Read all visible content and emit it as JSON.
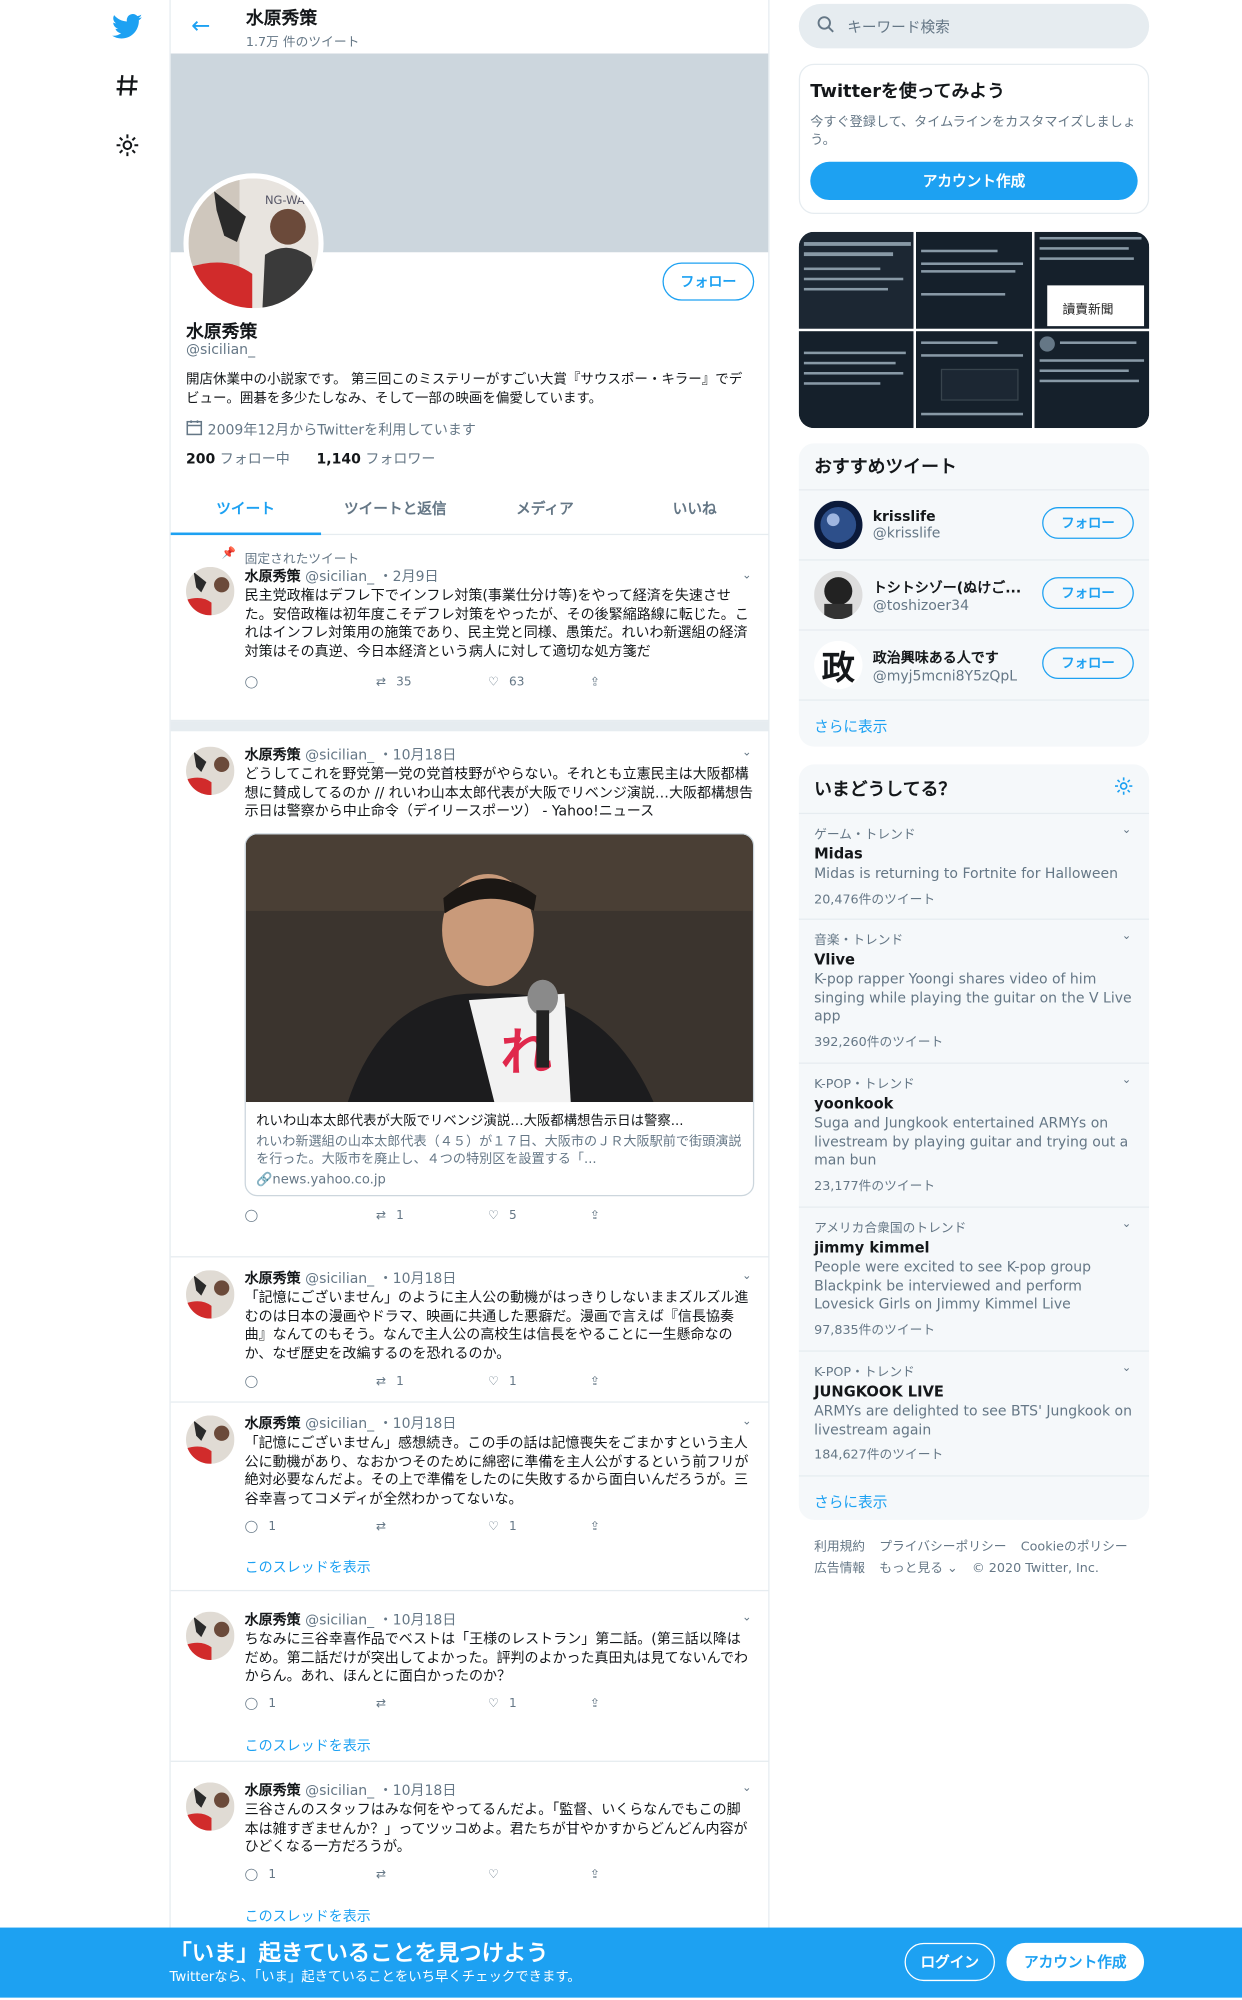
{
  "nav": {
    "items": [
      "twitter-logo",
      "explore",
      "settings"
    ]
  },
  "header": {
    "name": "水原秀策",
    "tweet_count": "1.7万 件のツイート"
  },
  "profile": {
    "name": "水原秀策",
    "handle": "@sicilian_",
    "follow_label": "フォロー",
    "bio": "開店休業中の小説家です。 第三回このミステリーがすごい大賞『サウスポー・キラー』でデビュー。囲碁を多少たしなみ、そして一部の映画を偏愛しています。",
    "joined": "2009年12月からTwitterを利用しています",
    "following_count": "200",
    "following_label": "フォロー中",
    "followers_count": "1,140",
    "followers_label": "フォロワー"
  },
  "tabs": [
    "ツイート",
    "ツイートと返信",
    "メディア",
    "いいね"
  ],
  "tweets": [
    {
      "pinned": "固定されたツイート",
      "name": "水原秀策",
      "handle": "@sicilian_",
      "date": "・2月9日",
      "text": "民主党政権はデフレ下でインフレ対策(事業仕分け等)をやって経済を失速させた。安倍政権は初年度こそデフレ対策をやったが、その後緊縮路線に転じた。これはインフレ対策用の施策であり、民主党と同様、愚策だ。れいわ新選組の経済対策はその真逆、今日本経済という病人に対して適切な処方箋だ",
      "reply": "",
      "retweet": "35",
      "like": "63"
    },
    {
      "name": "水原秀策",
      "handle": "@sicilian_",
      "date": "・10月18日",
      "text": "どうしてこれを野党第一党の党首枝野がやらない。それとも立憲民主は大阪都構想に賛成してるのか // れいわ山本太郎代表が大阪でリベンジ演説…大阪都構想告示日は警察から中止命令（デイリースポーツ） - Yahoo!ニュース",
      "card_title": "れいわ山本太郎代表が大阪でリベンジ演説…大阪都構想告示日は警察...",
      "card_desc": "れいわ新選組の山本太郎代表（４５）が１７日、大阪市のＪＲ大阪駅前で街頭演説を行った。大阪市を廃止し、４つの特別区を設置する「...",
      "card_domain": "news.yahoo.co.jp",
      "reply": "",
      "retweet": "1",
      "like": "5"
    },
    {
      "name": "水原秀策",
      "handle": "@sicilian_",
      "date": "・10月18日",
      "text": "「記憶にございません」のように主人公の動機がはっきりしないままズルズル進むのは日本の漫画やドラマ、映画に共通した悪癖だ。漫画で言えば『信長協奏曲』なんてのもそう。なんで主人公の高校生は信長をやることに一生懸命なのか、なぜ歴史を改編するのを恐れるのか。",
      "reply": "",
      "retweet": "1",
      "like": "1"
    },
    {
      "name": "水原秀策",
      "handle": "@sicilian_",
      "date": "・10月18日",
      "text": "「記憶にございません」感想続き。この手の話は記憶喪失をごまかすという主人公に動機があり、なおかつそのために綿密に準備を主人公がするという前フリが絶対必要なんだよ。その上で準備をしたのに失敗するから面白いんだろうが。三谷幸喜ってコメディが全然わかってないな。",
      "reply": "1",
      "retweet": "",
      "like": "1",
      "thread": "このスレッドを表示"
    },
    {
      "name": "水原秀策",
      "handle": "@sicilian_",
      "date": "・10月18日",
      "text": "ちなみに三谷幸喜作品でベストは「王様のレストラン」第二話。(第三話以降はだめ。第二話だけが突出してよかった。評判のよかった真田丸は見てないんでわからん。あれ、ほんとに面白かったのか？",
      "reply": "1",
      "retweet": "",
      "like": "1",
      "thread": "このスレッドを表示"
    },
    {
      "name": "水原秀策",
      "handle": "@sicilian_",
      "date": "・10月18日",
      "text": "三谷さんのスタッフはみな何をやってるんだよ。「監督、いくらなんでもこの脚本は雑すぎませんか？」ってツッコめよ。君たちが甘やかすからどんどん内容がひどくなる一方だろうが。",
      "reply": "1",
      "retweet": "",
      "like": "",
      "thread": "このスレッドを表示"
    }
  ],
  "sidebar": {
    "search_placeholder": "キーワード検索",
    "signup": {
      "title": "Twitterを使ってみよう",
      "desc": "今すぐ登録して、タイムラインをカスタマイズしましょう。",
      "button": "アカウント作成"
    },
    "recommend": {
      "title": "おすすめツイート",
      "users": [
        {
          "name": "krisslife",
          "handle": "@krisslife",
          "button": "フォロー"
        },
        {
          "name": "トシトシゾー(ぬけご...",
          "handle": "@toshizoer34",
          "button": "フォロー"
        },
        {
          "name": "政治興味ある人です",
          "handle": "@myj5mcni8Y5zQpL",
          "button": "フォロー",
          "avatar_char": "政"
        }
      ],
      "more": "さらに表示"
    },
    "trends": {
      "title": "いまどうしてる？",
      "items": [
        {
          "cat": "ゲーム・トレンド",
          "name": "Midas",
          "desc": "Midas is returning to Fortnite for Halloween",
          "count": "20,476件のツイート"
        },
        {
          "cat": "音楽・トレンド",
          "name": "Vlive",
          "desc": "K-pop rapper Yoongi shares video of him singing while playing the guitar on the V Live app",
          "count": "392,260件のツイート"
        },
        {
          "cat": "K-POP・トレンド",
          "name": "yoonkook",
          "desc": "Suga and Jungkook entertained ARMYs on livestream by playing guitar and trying out a man bun",
          "count": "23,177件のツイート"
        },
        {
          "cat": "アメリカ合衆国のトレンド",
          "name": "jimmy kimmel",
          "desc": "People were excited to see K-pop group Blackpink be interviewed and perform Lovesick Girls on Jimmy Kimmel Live",
          "count": "97,835件のツイート"
        },
        {
          "cat": "K-POP・トレンド",
          "name": "JUNGKOOK LIVE",
          "desc": "ARMYs are delighted to see BTS' Jungkook on livestream again",
          "count": "184,627件のツイート"
        }
      ],
      "more": "さらに表示"
    },
    "footer": {
      "terms": "利用規約",
      "privacy": "プライバシーポリシー",
      "cookie": "Cookieのポリシー",
      "ads": "広告情報",
      "more": "もっと見る ⌄",
      "copyright": "© 2020 Twitter, Inc."
    }
  },
  "bottom": {
    "title": "「いま」起きていることを見つけよう",
    "subtitle": "Twitterなら、「いま」起きていることをいち早くチェックできます。",
    "login": "ログイン",
    "create": "アカウント作成"
  },
  "colors": {
    "accent": "#1da1f2",
    "banner": "#ccd6dd",
    "muted": "#657786"
  }
}
